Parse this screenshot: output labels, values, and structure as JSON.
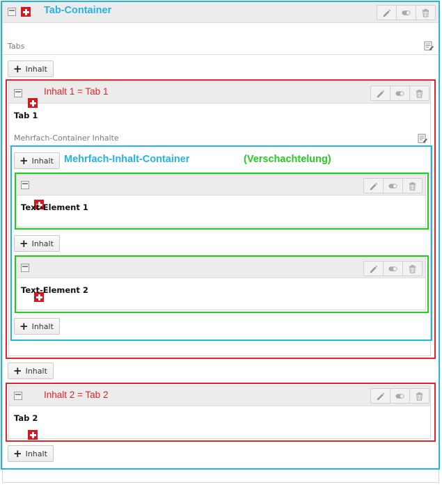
{
  "tab_container": {
    "label": "Tab-Container",
    "tabs_heading": "Tabs",
    "add_button": "Inhalt"
  },
  "inhalt1": {
    "label": "Inhalt 1 = Tab 1",
    "title": "Tab 1",
    "container_heading": "Mehrfach-Container Inhalte"
  },
  "multi_container": {
    "label": "Mehrfach-Inhalt-Container",
    "annotation": "(Verschachtelung)",
    "add_button": "Inhalt",
    "elements": [
      {
        "title": "Text-Element 1"
      },
      {
        "title": "Text-Element 2"
      }
    ]
  },
  "inhalt2": {
    "label": "Inhalt 2 = Tab 2",
    "title": "Tab 2"
  },
  "icons": {
    "edit": "pencil-icon",
    "toggle": "toggle-icon",
    "delete": "trash-icon",
    "record": "document-icon",
    "type": "swiss-cross-icon"
  },
  "colors": {
    "cyan": "#23b4e3",
    "red": "#e4232a",
    "green": "#22cc22"
  }
}
